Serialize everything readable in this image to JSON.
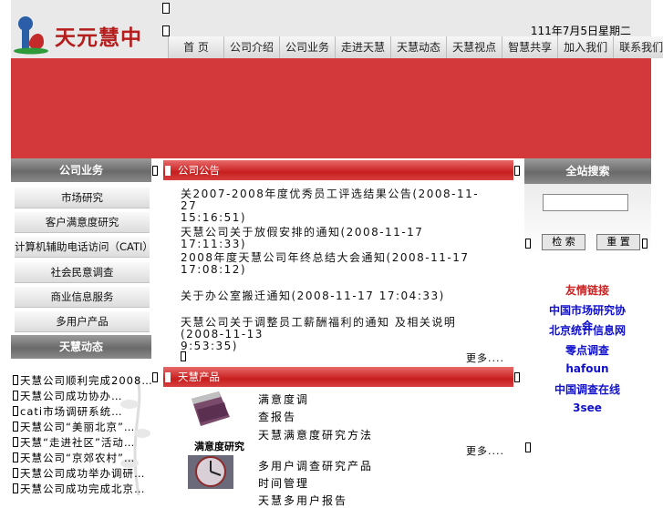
{
  "header": {
    "logo_text": "天元慧中",
    "date": "111年7月5日星期二",
    "nav": [
      "首  页",
      "公司介绍",
      "公司业务",
      "走进天慧",
      "天慧动态",
      "天慧视点",
      "智慧共享",
      "加入我们",
      "联系我们"
    ]
  },
  "left": {
    "business_title": "公司业务",
    "business_items": [
      "市场研究",
      "客户满意度研究",
      "计算机辅助电话访问（CATI）",
      "社会民意调查",
      "商业信息服务",
      "多用户产品"
    ],
    "news_title": "天慧动态",
    "news_items": [
      "天慧公司顺利完成2008…",
      "天慧公司成功协办…",
      "cati市场调研系统…",
      "天慧公司“美丽北京”…",
      "天慧“走进社区”活动…",
      "天慧公司“京郊农村”…",
      "天慧公司成功举办调研…",
      "天慧公司成功完成北京…"
    ]
  },
  "center": {
    "announce_title": "公司公告",
    "announcements": [
      {
        "line1": "关2007-2008年度优秀员工评选结果公告(2008-11-27",
        "line2": "15:16:51)"
      },
      {
        "line1": "天慧公司关于放假安排的通知(2008-11-17 17:11:33)",
        "line2": ""
      },
      {
        "line1": "2008年度天慧公司年终总结大会通知(2008-11-17",
        "line2": "17:08:12)"
      },
      {
        "line1": "关于办公室搬迁通知(2008-11-17 17:04:33)",
        "line2": ""
      },
      {
        "line1": "天慧公司关于调整员工薪酬福利的通知 及相关说明(2008-11-13",
        "line2": "9:53:35)"
      }
    ],
    "more_label": "更多....",
    "products_title": "天慧产品",
    "product1_caption": "满意度研究",
    "product1_lines": [
      "满意度调",
      "查报告",
      "天慧满意度研究方法"
    ],
    "product2_lines": [
      "多用户调查研究产品",
      "时间管理",
      "天慧多用户报告"
    ]
  },
  "right": {
    "search_title": "全站搜索",
    "search_placeholder": "",
    "search_button": "检 索",
    "reset_button": "重 置",
    "links": [
      "友情链接",
      "中国市场研究协会",
      "北京统计信息网",
      "零点调查",
      "hafoun",
      "中国调查在线",
      "3see"
    ],
    "link_colors": {
      "first": "#cc2222",
      "rest": "#1010cc"
    }
  }
}
